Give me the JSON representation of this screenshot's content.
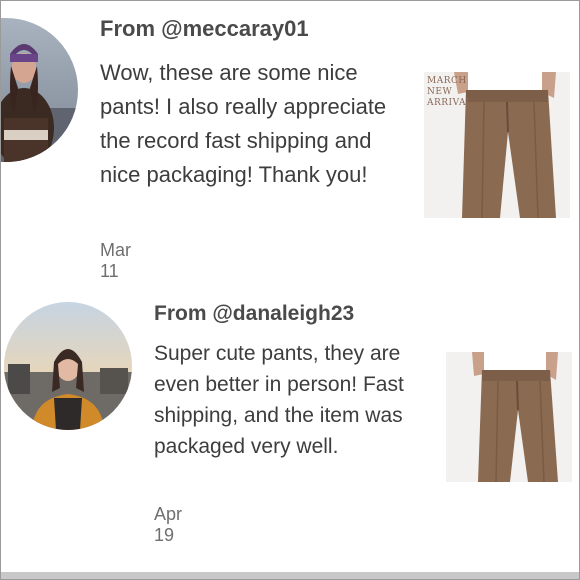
{
  "reviews": [
    {
      "from": "From @meccaray01",
      "text": "Wow, these are some nice pants! I also really appreciate the record fast shipping and nice packaging! Thank you!",
      "date": "Mar 11",
      "avatar_icon": "user-photo",
      "thumb_icon": "pants-photo",
      "watermark": [
        "MARCH",
        "NEW",
        "ARRIVAL"
      ]
    },
    {
      "from": "From @danaleigh23",
      "text": "Super cute pants, they are even better in person! Fast shipping, and the item was packaged very well.",
      "date": "Apr 19",
      "avatar_icon": "user-photo",
      "thumb_icon": "pants-photo"
    }
  ],
  "colors": {
    "pants": "#8b6a52",
    "shirt": "#ffffff",
    "skin": "#c9a08a",
    "text": "#3d3d3d",
    "date": "#6f6f6f"
  }
}
